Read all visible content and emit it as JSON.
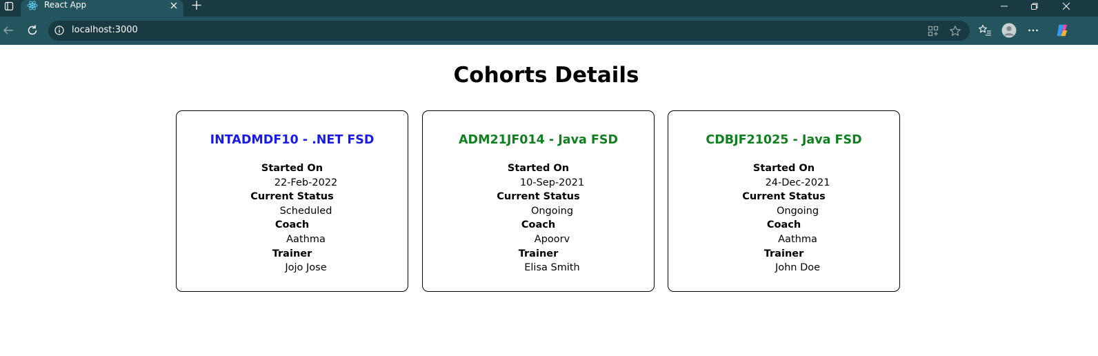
{
  "browser": {
    "tab_title": "React App",
    "url": "localhost:3000"
  },
  "page": {
    "title": "Cohorts Details",
    "field_labels": {
      "started_on": "Started On",
      "current_status": "Current Status",
      "coach": "Coach",
      "trainer": "Trainer"
    }
  },
  "cohorts": [
    {
      "title": "INTADMDF10 - .NET FSD",
      "title_color": "#1a1ae6",
      "started_on": "22-Feb-2022",
      "current_status": "Scheduled",
      "coach": "Aathma",
      "trainer": "Jojo Jose"
    },
    {
      "title": "ADM21JF014 - Java FSD",
      "title_color": "#0f7f1f",
      "started_on": "10-Sep-2021",
      "current_status": "Ongoing",
      "coach": "Apoorv",
      "trainer": "Elisa Smith"
    },
    {
      "title": "CDBJF21025 - Java FSD",
      "title_color": "#0f7f1f",
      "started_on": "24-Dec-2021",
      "current_status": "Ongoing",
      "coach": "Aathma",
      "trainer": "John Doe"
    }
  ]
}
